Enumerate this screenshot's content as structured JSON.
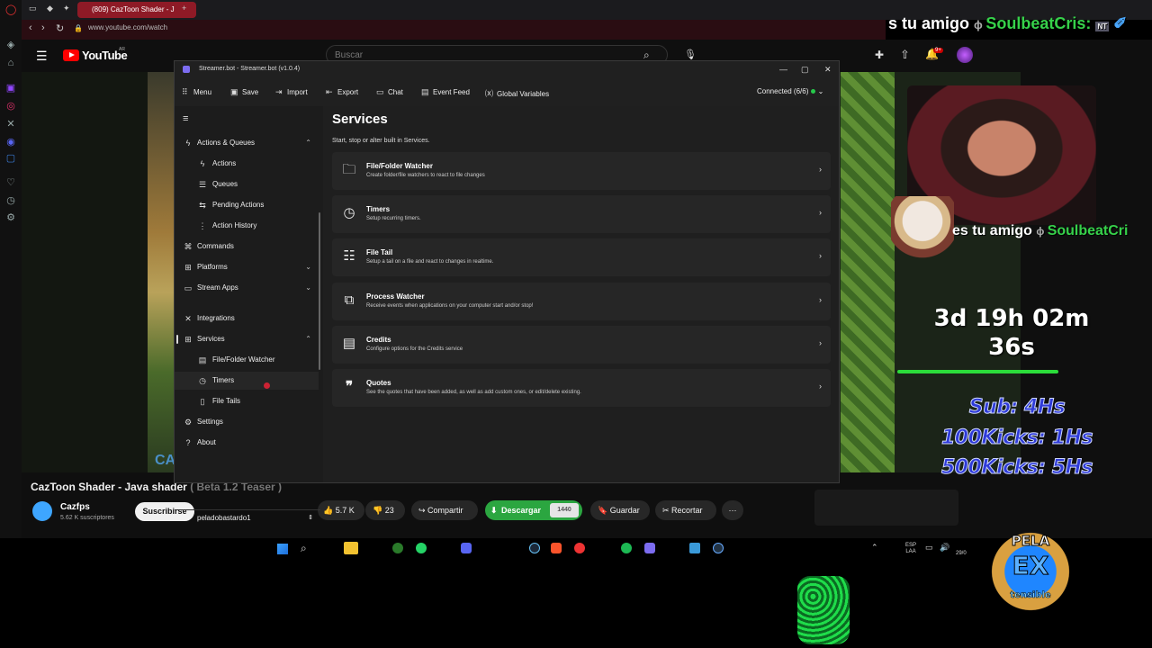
{
  "browser": {
    "tab_title": "(809) CazToon Shader - J",
    "url": "www.youtube.com/watch"
  },
  "youtube": {
    "logo_text": "YouTube",
    "region": "AR",
    "search_placeholder": "Buscar",
    "notifications": "9+",
    "video_title": "CazToon Shader - Java shader",
    "video_title_suffix": "( Beta 1.2 Teaser )",
    "channel_name": "Cazfps",
    "subscribers": "5.62 K suscriptores",
    "subscribe_label": "Suscribirse",
    "likes": "5.7 K",
    "dislikes": "23",
    "share_label": "Compartir",
    "download_label": "Descargar",
    "download_quality": "1440",
    "save_label": "Guardar",
    "clip_label": "Recortar",
    "video_overlay_text": "CA"
  },
  "overlay": {
    "chat_line_1_left": "s tu amigo",
    "chat_line_1_user": "SoulbeatCris:",
    "chat_line_1_badge": "NT",
    "chat_line_2_left": "es tu amigo",
    "chat_line_2_user": "SoulbeatCri",
    "timer_line_1": "3d 19h 02m",
    "timer_line_2": "36s",
    "timer_progress": 0.71,
    "goal_1": "Sub: 4Hs",
    "goal_2": "100Kicks: 1Hs",
    "goal_3": "500Kicks: 5Hs",
    "logo_top": "PELA",
    "logo_mid": "EX",
    "logo_bot": "tensible"
  },
  "taskbar": {
    "lang": "ESP",
    "lang_sub": "LAA",
    "date": "29/0"
  },
  "streamerbot": {
    "window_title": "Streamer.bot - Streamer.bot (v1.0.4)",
    "menu": [
      "Menu",
      "Save",
      "Import",
      "Export",
      "Chat",
      "Event Feed",
      "Global Variables"
    ],
    "status": "Connected (6/6)",
    "sidebar": {
      "actions_queues": "Actions & Queues",
      "actions": "Actions",
      "queues": "Queues",
      "pending_actions": "Pending Actions",
      "action_history": "Action History",
      "commands": "Commands",
      "platforms": "Platforms",
      "stream_apps": "Stream Apps",
      "integrations": "Integrations",
      "services": "Services",
      "file_folder_watcher": "File/Folder Watcher",
      "timers": "Timers",
      "file_tails": "File Tails",
      "settings": "Settings",
      "about": "About",
      "user": "peladobastardo1"
    },
    "page_title": "Services",
    "page_subtitle": "Start, stop or alter built in Services.",
    "services": [
      {
        "icon": "folder-watch-icon",
        "title": "File/Folder Watcher",
        "desc": "Create folder/file watchers to react to file changes"
      },
      {
        "icon": "stopwatch-icon",
        "title": "Timers",
        "desc": "Setup recurring timers."
      },
      {
        "icon": "file-tail-icon",
        "title": "File Tail",
        "desc": "Setup a tail on a file and react to changes in realtime."
      },
      {
        "icon": "process-icon",
        "title": "Process Watcher",
        "desc": "Receive events when applications on your computer start and/or stop!"
      },
      {
        "icon": "credits-icon",
        "title": "Credits",
        "desc": "Configure options for the Credits service"
      },
      {
        "icon": "quote-icon",
        "title": "Quotes",
        "desc": "See the quotes that have been added, as well as add custom ones, or edit/delete existing."
      }
    ]
  }
}
